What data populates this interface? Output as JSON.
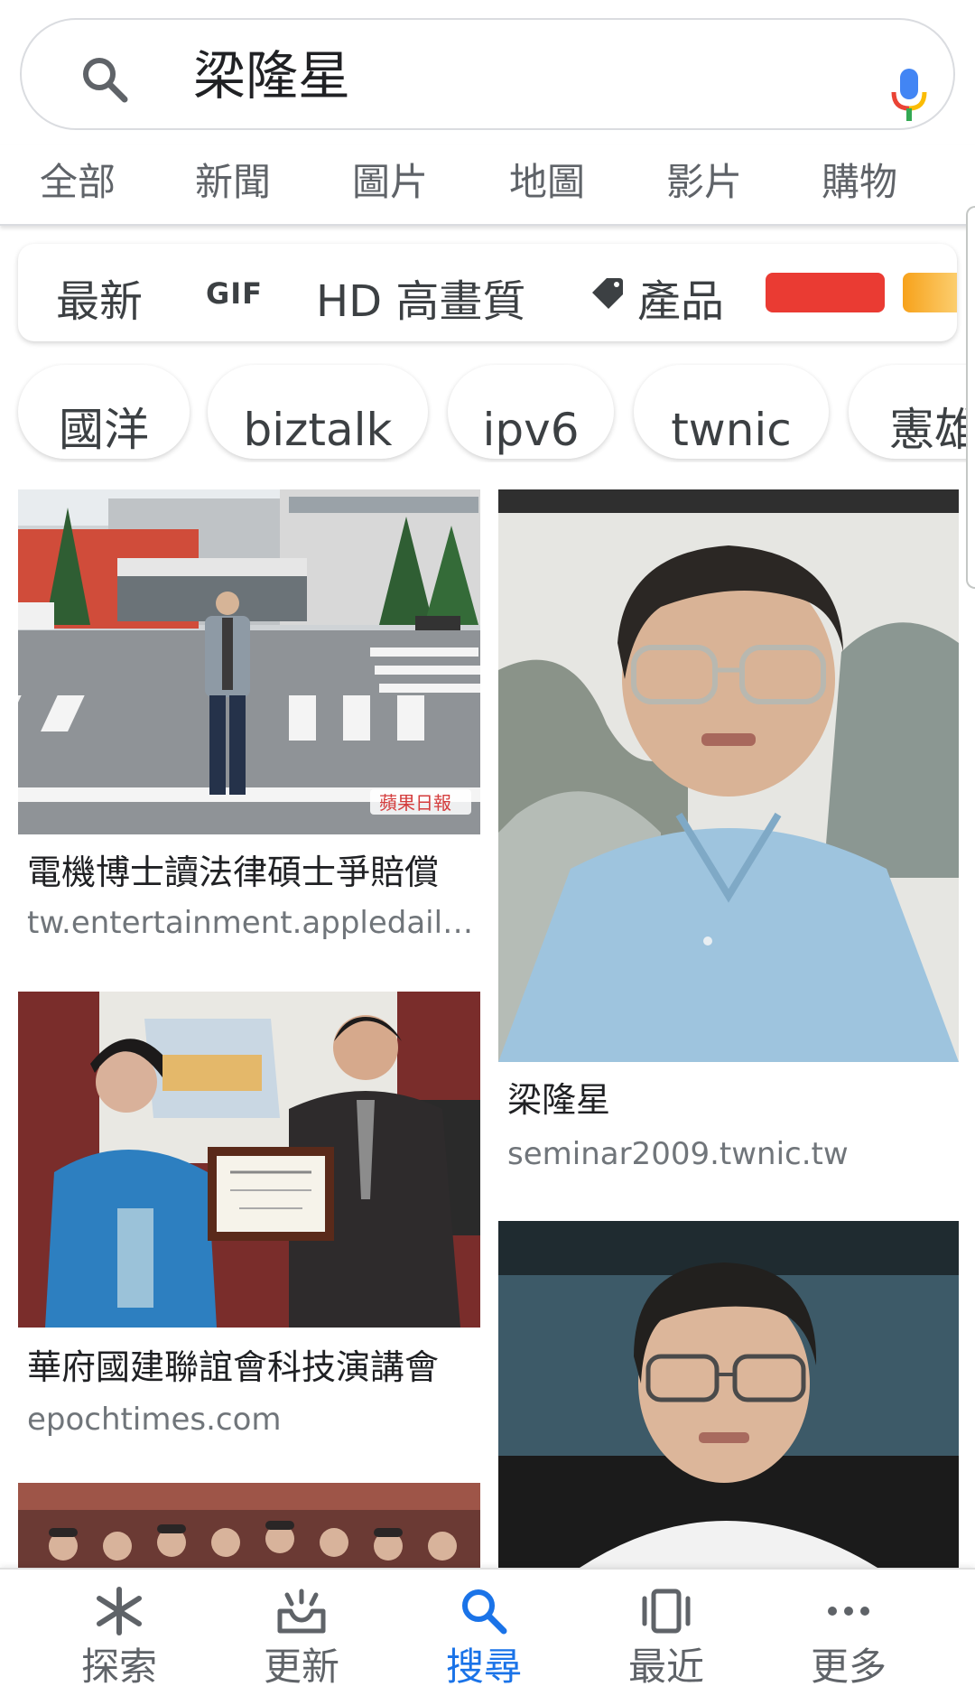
{
  "search": {
    "query": "梁隆星"
  },
  "tabs": [
    {
      "label": "全部"
    },
    {
      "label": "新聞"
    },
    {
      "label": "圖片"
    },
    {
      "label": "地圖"
    },
    {
      "label": "影片"
    },
    {
      "label": "購物"
    }
  ],
  "filters": {
    "recent": "最新",
    "gif": "GIF",
    "hd": "HD 高畫質",
    "products": "產品",
    "color_red": "#ea3b33",
    "color_orange": "#f7a21b"
  },
  "chips": [
    {
      "label": "國洋"
    },
    {
      "label": "biztalk"
    },
    {
      "label": "ipv6"
    },
    {
      "label": "twnic"
    },
    {
      "label": "憲雄"
    }
  ],
  "results": [
    {
      "title": "電機博士讀法律碩士爭賠償",
      "source": "tw.entertainment.appledaily.com.tw",
      "watermark": "蘋果日報"
    },
    {
      "title": "梁隆星",
      "source": "seminar2009.twnic.tw"
    },
    {
      "title": "華府國建聯誼會科技演講會",
      "source": "epochtimes.com"
    }
  ],
  "bottom_nav": [
    {
      "label": "探索",
      "icon": "discover-icon"
    },
    {
      "label": "更新",
      "icon": "updates-icon"
    },
    {
      "label": "搜尋",
      "icon": "search-icon",
      "active": true
    },
    {
      "label": "最近",
      "icon": "recent-icon"
    },
    {
      "label": "更多",
      "icon": "more-icon"
    }
  ],
  "colors": {
    "accent": "#1a73e8",
    "text_secondary": "#5f6368"
  }
}
